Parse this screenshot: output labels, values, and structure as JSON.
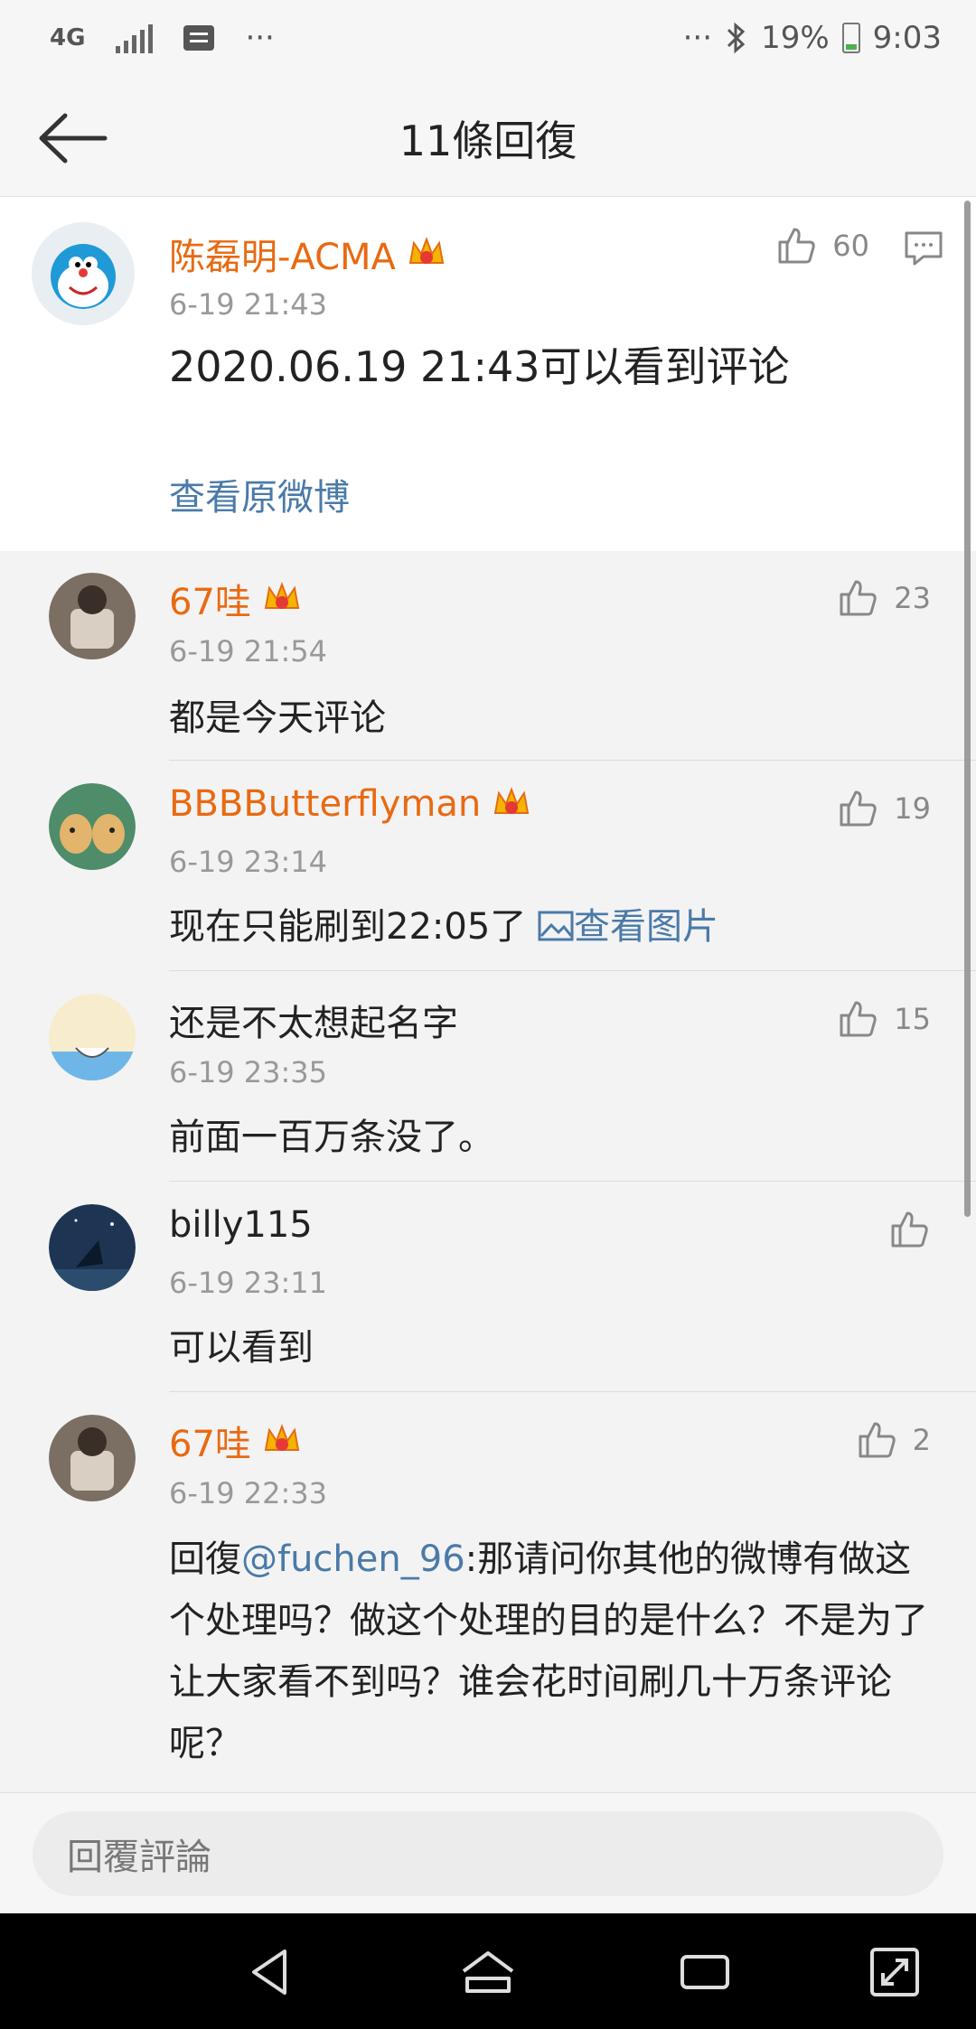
{
  "status_bar": {
    "network": "4G",
    "more_left": "···",
    "more_right": "···",
    "battery": "19%",
    "time": "9:03"
  },
  "header": {
    "title": "11條回復"
  },
  "original_comment": {
    "username": "陈磊明-ACMA",
    "time": "6-19 21:43",
    "likes": "60",
    "text": "2020.06.19 21:43可以看到评论",
    "view_original": "查看原微博"
  },
  "replies": [
    {
      "username": "67哇",
      "time": "6-19 21:54",
      "likes": "23",
      "text": "都是今天评论",
      "vip": true
    },
    {
      "username": "BBBButterflyman",
      "time": "6-19 23:14",
      "likes": "19",
      "text": "现在只能刷到22:05了 ",
      "image_link": "查看图片",
      "vip": true
    },
    {
      "username": "还是不太想起名字",
      "time": "6-19 23:35",
      "likes": "15",
      "text": "前面一百万条没了。",
      "vip": false
    },
    {
      "username": "billy115",
      "time": "6-19 23:11",
      "likes": "",
      "text": "可以看到",
      "vip": false
    },
    {
      "username": "67哇",
      "time": "6-19 22:33",
      "likes": "2",
      "reply_prefix": "回復",
      "mention": "@fuchen_96",
      "text": ":那请问你其他的微博有做这个处理吗？做这个处理的目的是什么？不是为了让大家看不到吗？谁会花时间刷几十万条评论呢？",
      "vip": true
    }
  ],
  "reply_bar": {
    "placeholder": "回覆評論"
  },
  "colors": {
    "vip_name": "#e86a12",
    "link": "#4a7aa8"
  }
}
